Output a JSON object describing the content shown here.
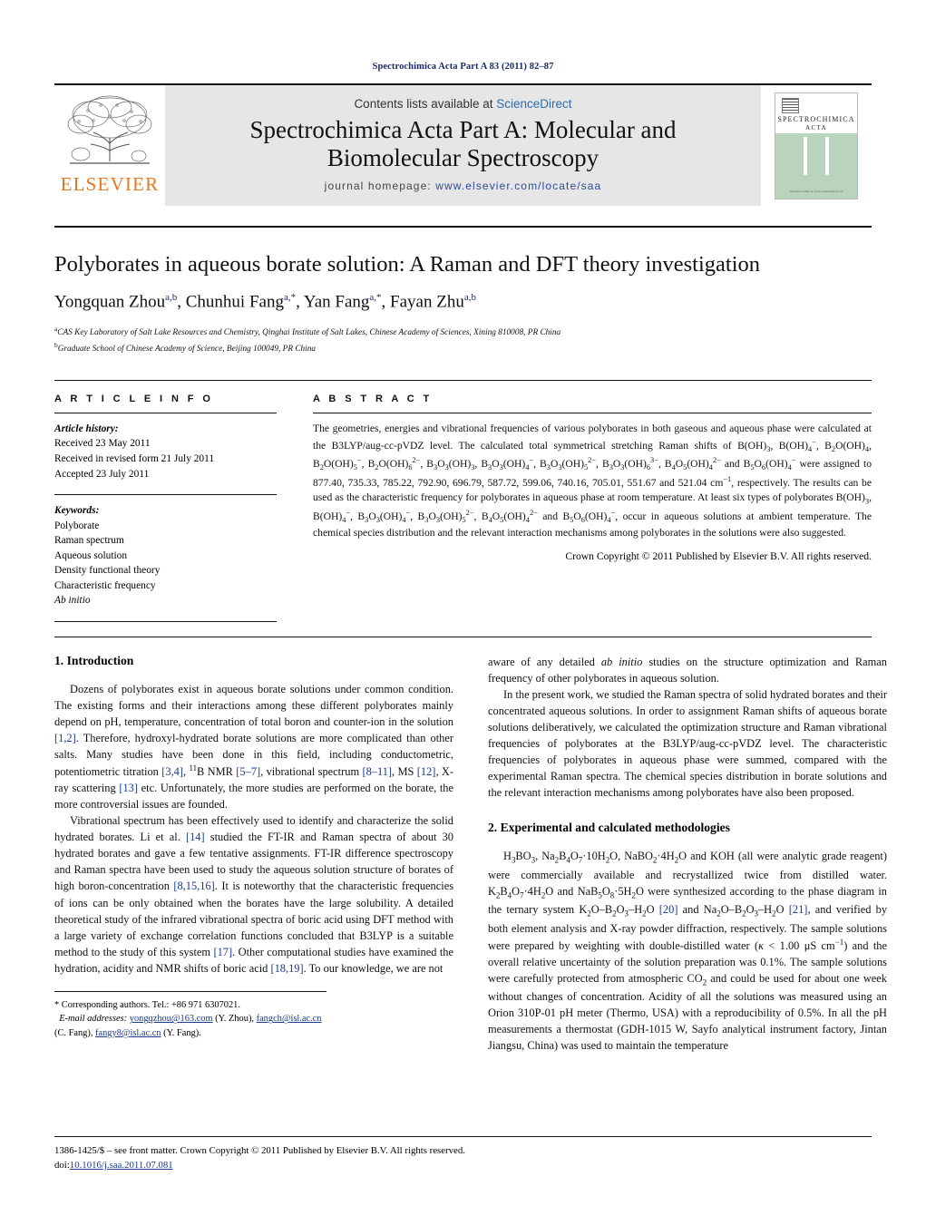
{
  "running_head": "Spectrochimica Acta Part A 83 (2011) 82–87",
  "masthead": {
    "contents_prefix": "Contents lists available at ",
    "contents_link": "ScienceDirect",
    "journal_title_line1": "Spectrochimica Acta Part A: Molecular and",
    "journal_title_line2": "Biomolecular Spectroscopy",
    "homepage_label": "journal homepage:",
    "homepage_url": "www.elsevier.com/locate/saa",
    "publisher_logo_text": "ELSEVIER",
    "cover": {
      "line1": "SPECTROCHIMICA",
      "line2": "ACTA",
      "line3": "PART A: MOLECULAR AND BIOMOLECULAR SPECTROSCOPY",
      "footer": "Available online at www.sciencedirect.com"
    }
  },
  "article": {
    "title": "Polyborates in aqueous borate solution: A Raman and DFT theory investigation",
    "authors": "Yongquan Zhou, Chunhui Fang, Yan Fang, Fayan Zhu",
    "author_list": [
      {
        "name": "Yongquan Zhou",
        "marks": "a,b"
      },
      {
        "name": "Chunhui Fang",
        "marks": "a,*"
      },
      {
        "name": "Yan Fang",
        "marks": "a,*"
      },
      {
        "name": "Fayan Zhu",
        "marks": "a,b"
      }
    ],
    "affiliations": [
      {
        "mark": "a",
        "text": "CAS Key Laboratory of Salt Lake Resources and Chemistry, Qinghai Institute of Salt Lakes, Chinese Academy of Sciences, Xining 810008, PR China"
      },
      {
        "mark": "b",
        "text": "Graduate School of Chinese Academy of Science, Beijing 100049, PR China"
      }
    ]
  },
  "article_info": {
    "heading": "A R T I C L E   I N F O",
    "history_label": "Article history:",
    "history": [
      "Received 23 May 2011",
      "Received in revised form 21 July 2011",
      "Accepted 23 July 2011"
    ],
    "keywords_label": "Keywords:",
    "keywords": [
      "Polyborate",
      "Raman spectrum",
      "Aqueous solution",
      "Density functional theory",
      "Characteristic frequency",
      "Ab initio"
    ]
  },
  "abstract": {
    "heading": "A B S T R A C T",
    "copyright": "Crown Copyright © 2011 Published by Elsevier B.V. All rights reserved."
  },
  "sections": {
    "intro_heading": "1.  Introduction",
    "methods_heading": "2.  Experimental and calculated methodologies"
  },
  "footnote": {
    "corresponding": "* Corresponding authors. Tel.: +86 971 6307021.",
    "email_label": "E-mail addresses:",
    "emails": [
      {
        "addr": "yongqzhou@163.com",
        "who": "(Y. Zhou)"
      },
      {
        "addr": "fangch@isl.ac.cn",
        "who": "(C. Fang)"
      },
      {
        "addr": "fangy8@isl.ac.cn",
        "who": "(Y. Fang)"
      }
    ]
  },
  "page_footer": {
    "issn_line": "1386-1425/$ – see front matter. Crown Copyright © 2011 Published by Elsevier B.V. All rights reserved.",
    "doi_label": "doi:",
    "doi": "10.1016/j.saa.2011.07.081"
  },
  "colors": {
    "accent_orange": "#E87722",
    "link_blue": "#2b6cb0",
    "cite_blue": "#1a3a8f",
    "masthead_grey": "#e6e6e6",
    "cover_green": "#b9d3bd"
  }
}
